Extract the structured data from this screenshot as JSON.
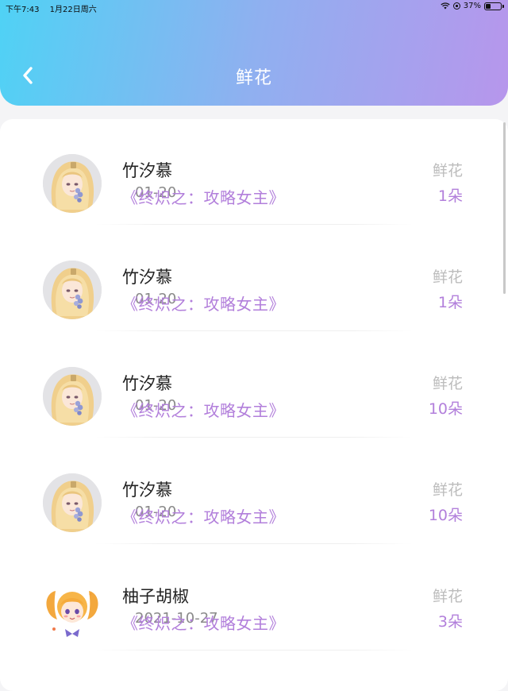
{
  "status_bar": {
    "time": "下午7:43",
    "date": "1月22日周六",
    "battery_text": "37%",
    "battery_level": 0.37
  },
  "header": {
    "title": "鲜花",
    "back_icon": "chevron-left-icon"
  },
  "colors": {
    "gradient_start": "#4fd2f5",
    "gradient_end": "#b796ec",
    "accent_purple": "#b27fdb"
  },
  "records": [
    {
      "name": "竹汐慕",
      "date": "01-20",
      "book": "《终炽之：攻略女主》",
      "type": "鲜花",
      "count": "1朵",
      "avatar": "blonde-girl"
    },
    {
      "name": "竹汐慕",
      "date": "01-20",
      "book": "《终炽之：攻略女主》",
      "type": "鲜花",
      "count": "1朵",
      "avatar": "blonde-girl"
    },
    {
      "name": "竹汐慕",
      "date": "01-20",
      "book": "《终炽之：攻略女主》",
      "type": "鲜花",
      "count": "10朵",
      "avatar": "blonde-girl"
    },
    {
      "name": "竹汐慕",
      "date": "01-20",
      "book": "《终炽之：攻略女主》",
      "type": "鲜花",
      "count": "10朵",
      "avatar": "blonde-girl"
    },
    {
      "name": "柚子胡椒",
      "date": "2021-10-27",
      "book": "《终炽之：攻略女主》",
      "type": "鲜花",
      "count": "3朵",
      "avatar": "twin-tails-girl"
    }
  ]
}
